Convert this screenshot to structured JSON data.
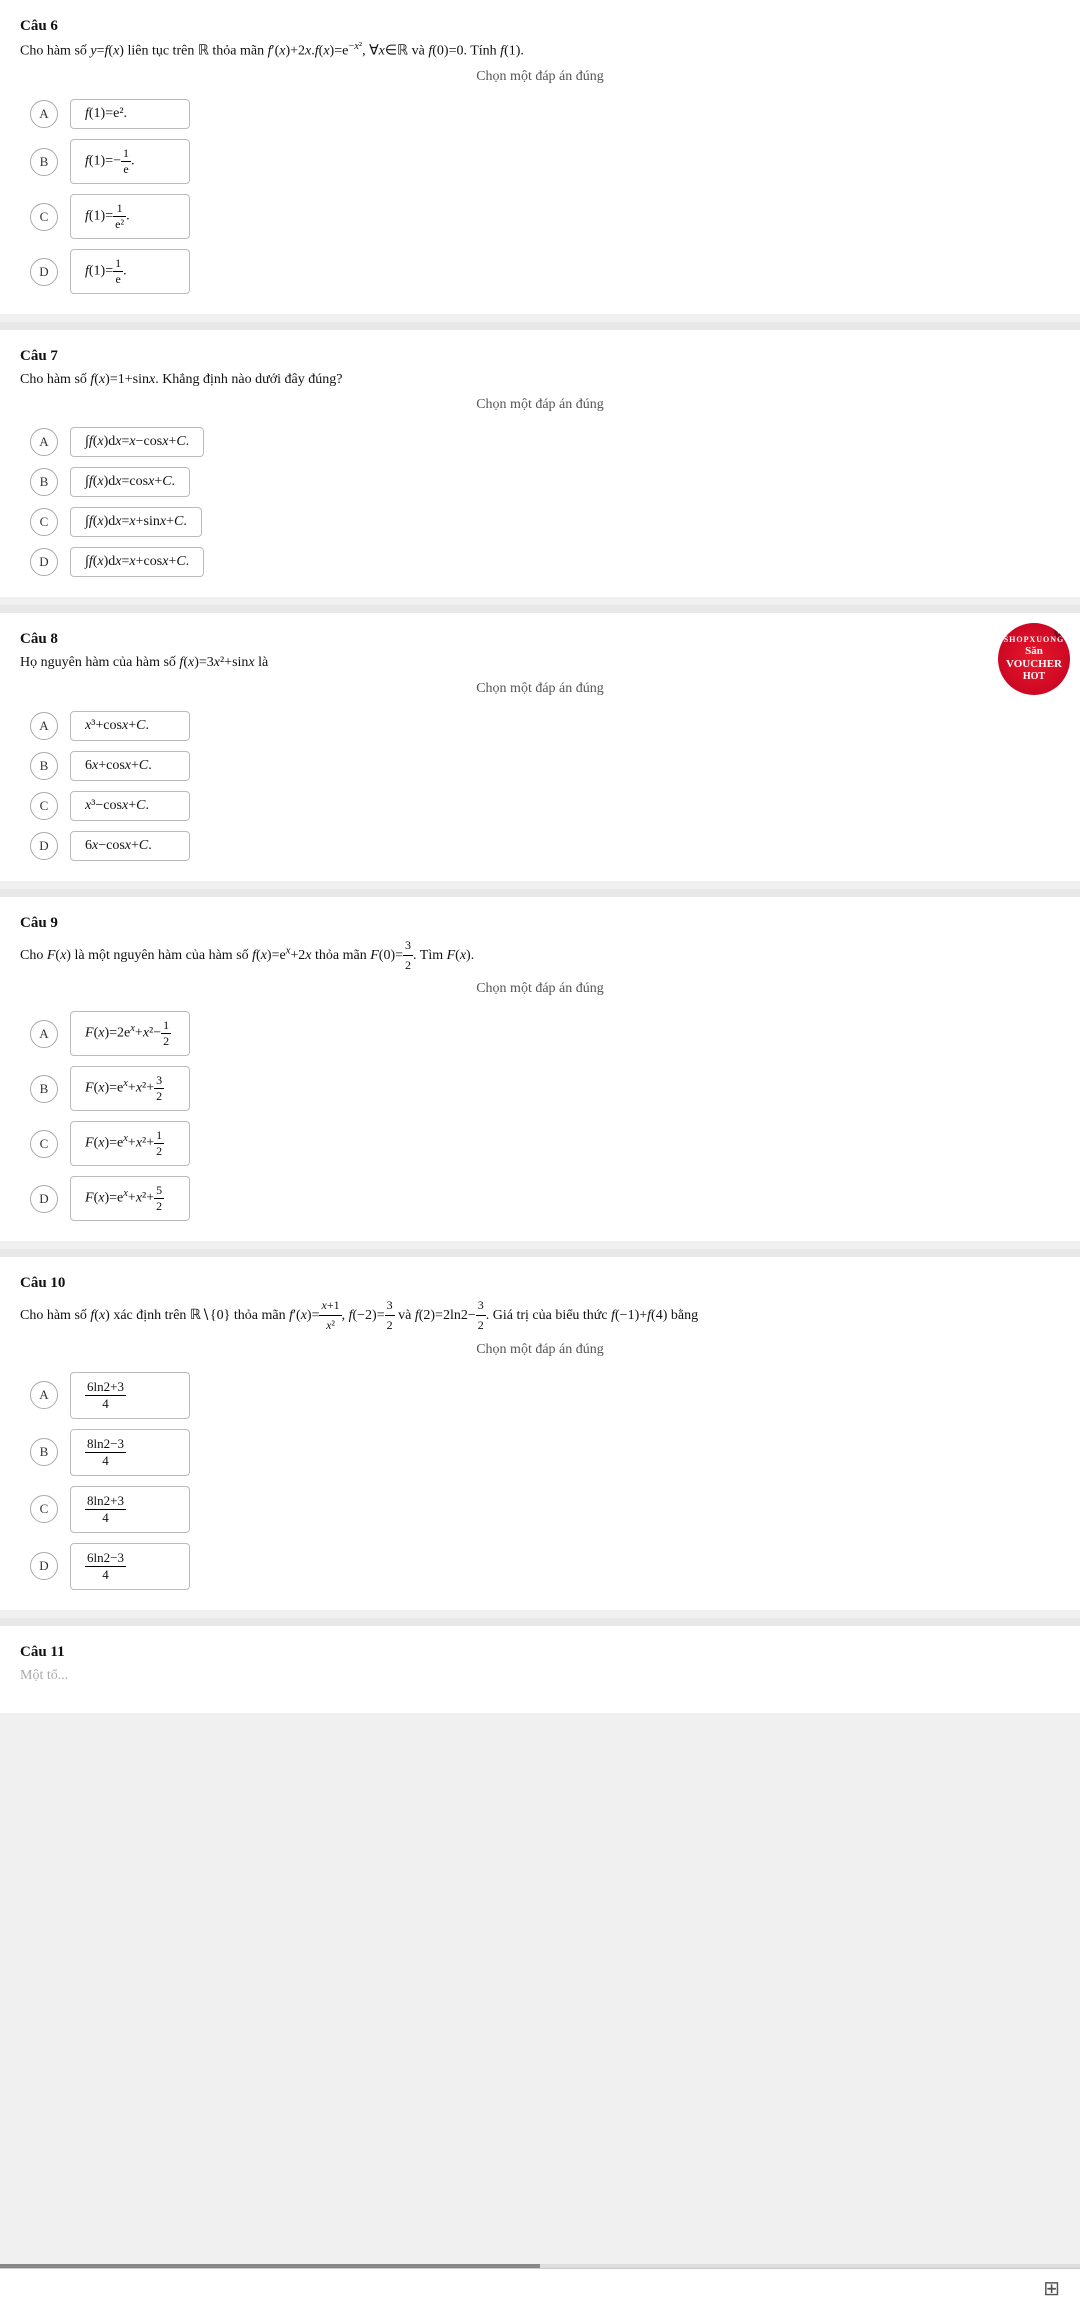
{
  "questions": [
    {
      "id": "q6",
      "number": "Câu 6",
      "text_html": "Cho hàm số <i>y</i>=<i>f</i>(<i>x</i>) liên tục trên ℝ thỏa mãn <i>f</i>′(<i>x</i>)+2<i>x</i>.<i>f</i>(<i>x</i>)=e<sup>−x²</sup>, ∀<i>x</i>∈ℝ và <i>f</i>(0)=0. Tính <i>f</i>(1).",
      "choose_label": "Chọn một đáp án đúng",
      "options": [
        {
          "letter": "A",
          "text_html": "<i>f</i>(1)=e²."
        },
        {
          "letter": "B",
          "text_html": "<i>f</i>(1)=−<sup>1</sup>⁄<sub>e</sub>."
        },
        {
          "letter": "C",
          "text_html": "<i>f</i>(1)=<sup>1</sup>⁄<sub>e²</sub>."
        },
        {
          "letter": "D",
          "text_html": "<i>f</i>(1)=<sup>1</sup>⁄<sub>e</sub>."
        }
      ],
      "has_voucher": false
    },
    {
      "id": "q7",
      "number": "Câu 7",
      "text_html": "Cho hàm số <i>f</i>(<i>x</i>)=1+sin<i>x</i>. Khẳng định nào dưới đây đúng?",
      "choose_label": "Chọn một đáp án đúng",
      "options": [
        {
          "letter": "A",
          "text_html": "∫<i>f</i>(<i>x</i>)d<i>x</i>=<i>x</i>−cos<i>x</i>+<i>C</i>."
        },
        {
          "letter": "B",
          "text_html": "∫<i>f</i>(<i>x</i>)d<i>x</i>=cos<i>x</i>+<i>C</i>."
        },
        {
          "letter": "C",
          "text_html": "∫<i>f</i>(<i>x</i>)d<i>x</i>=<i>x</i>+sin<i>x</i>+<i>C</i>."
        },
        {
          "letter": "D",
          "text_html": "∫<i>f</i>(<i>x</i>)d<i>x</i>=<i>x</i>+cos<i>x</i>+<i>C</i>."
        }
      ],
      "has_voucher": false
    },
    {
      "id": "q8",
      "number": "Câu 8",
      "text_html": "Họ nguyên hàm của hàm số <i>f</i>(<i>x</i>)=3<i>x</i>²+sin<i>x</i> là",
      "choose_label": "Chọn một đáp án đúng",
      "options": [
        {
          "letter": "A",
          "text_html": "<i>x</i>³+cos<i>x</i>+<i>C</i>."
        },
        {
          "letter": "B",
          "text_html": "6<i>x</i>+cos<i>x</i>+<i>C</i>."
        },
        {
          "letter": "C",
          "text_html": "<i>x</i>³−cos<i>x</i>+<i>C</i>."
        },
        {
          "letter": "D",
          "text_html": "6<i>x</i>−cos<i>x</i>+<i>C</i>."
        }
      ],
      "has_voucher": true
    },
    {
      "id": "q9",
      "number": "Câu 9",
      "text_html": "Cho <i>F</i>(<i>x</i>) là một nguyên hàm của hàm số <i>f</i>(<i>x</i>)=e<sup><i>x</i></sup>+2<i>x</i> thỏa mãn <i>F</i>(0)=<sup>3</sup>⁄<sub>2</sub>. Tìm <i>F</i>(<i>x</i>).",
      "choose_label": "Chọn một đáp án đúng",
      "options": [
        {
          "letter": "A",
          "text_html": "<i>F</i>(<i>x</i>)=2e<sup><i>x</i></sup>+<i>x</i>²−<sup>1</sup>⁄<sub>2</sub>"
        },
        {
          "letter": "B",
          "text_html": "<i>F</i>(<i>x</i>)=e<sup><i>x</i></sup>+<i>x</i>²+<sup>3</sup>⁄<sub>2</sub>"
        },
        {
          "letter": "C",
          "text_html": "<i>F</i>(<i>x</i>)=e<sup><i>x</i></sup>+<i>x</i>²+<sup>1</sup>⁄<sub>2</sub>"
        },
        {
          "letter": "D",
          "text_html": "<i>F</i>(<i>x</i>)=e<sup><i>x</i></sup>+<i>x</i>²+<sup>5</sup>⁄<sub>2</sub>"
        }
      ],
      "has_voucher": false
    },
    {
      "id": "q10",
      "number": "Câu 10",
      "text_html": "Cho hàm số <i>f</i>(<i>x</i>) xác định trên ℝ∖{0} thỏa mãn <i>f</i>′(<i>x</i>)=<sup><i>x</i>+1</sup>⁄<sub><i>x</i>²</sub>, <i>f</i>(−2)=<sup>3</sup>⁄<sub>2</sub> và <i>f</i>(2)=2ln2−<sup>3</sup>⁄<sub>2</sub>. Giá trị của biểu thức <i>f</i>(−1)+<i>f</i>(4) bằng",
      "choose_label": "Chọn một đáp án đúng",
      "options": [
        {
          "letter": "A",
          "text_html": "<sup>6ln2+3</sup>⁄<sub>4</sub>"
        },
        {
          "letter": "B",
          "text_html": "<sup>8ln2−3</sup>⁄<sub>4</sub>"
        },
        {
          "letter": "C",
          "text_html": "<sup>8ln2+3</sup>⁄<sub>4</sub>"
        },
        {
          "letter": "D",
          "text_html": "<sup>6ln2−3</sup>⁄<sub>4</sub>"
        }
      ],
      "has_voucher": false
    },
    {
      "id": "q11",
      "number": "Câu 11",
      "text_html": "",
      "choose_label": "",
      "options": [],
      "has_voucher": false
    }
  ],
  "bottom_bar": {
    "grid_icon": "⊞"
  },
  "voucher": {
    "san": "SHOPXUONG",
    "line1": "Săn",
    "line2": "VOUCHER",
    "line3": "HOT"
  }
}
